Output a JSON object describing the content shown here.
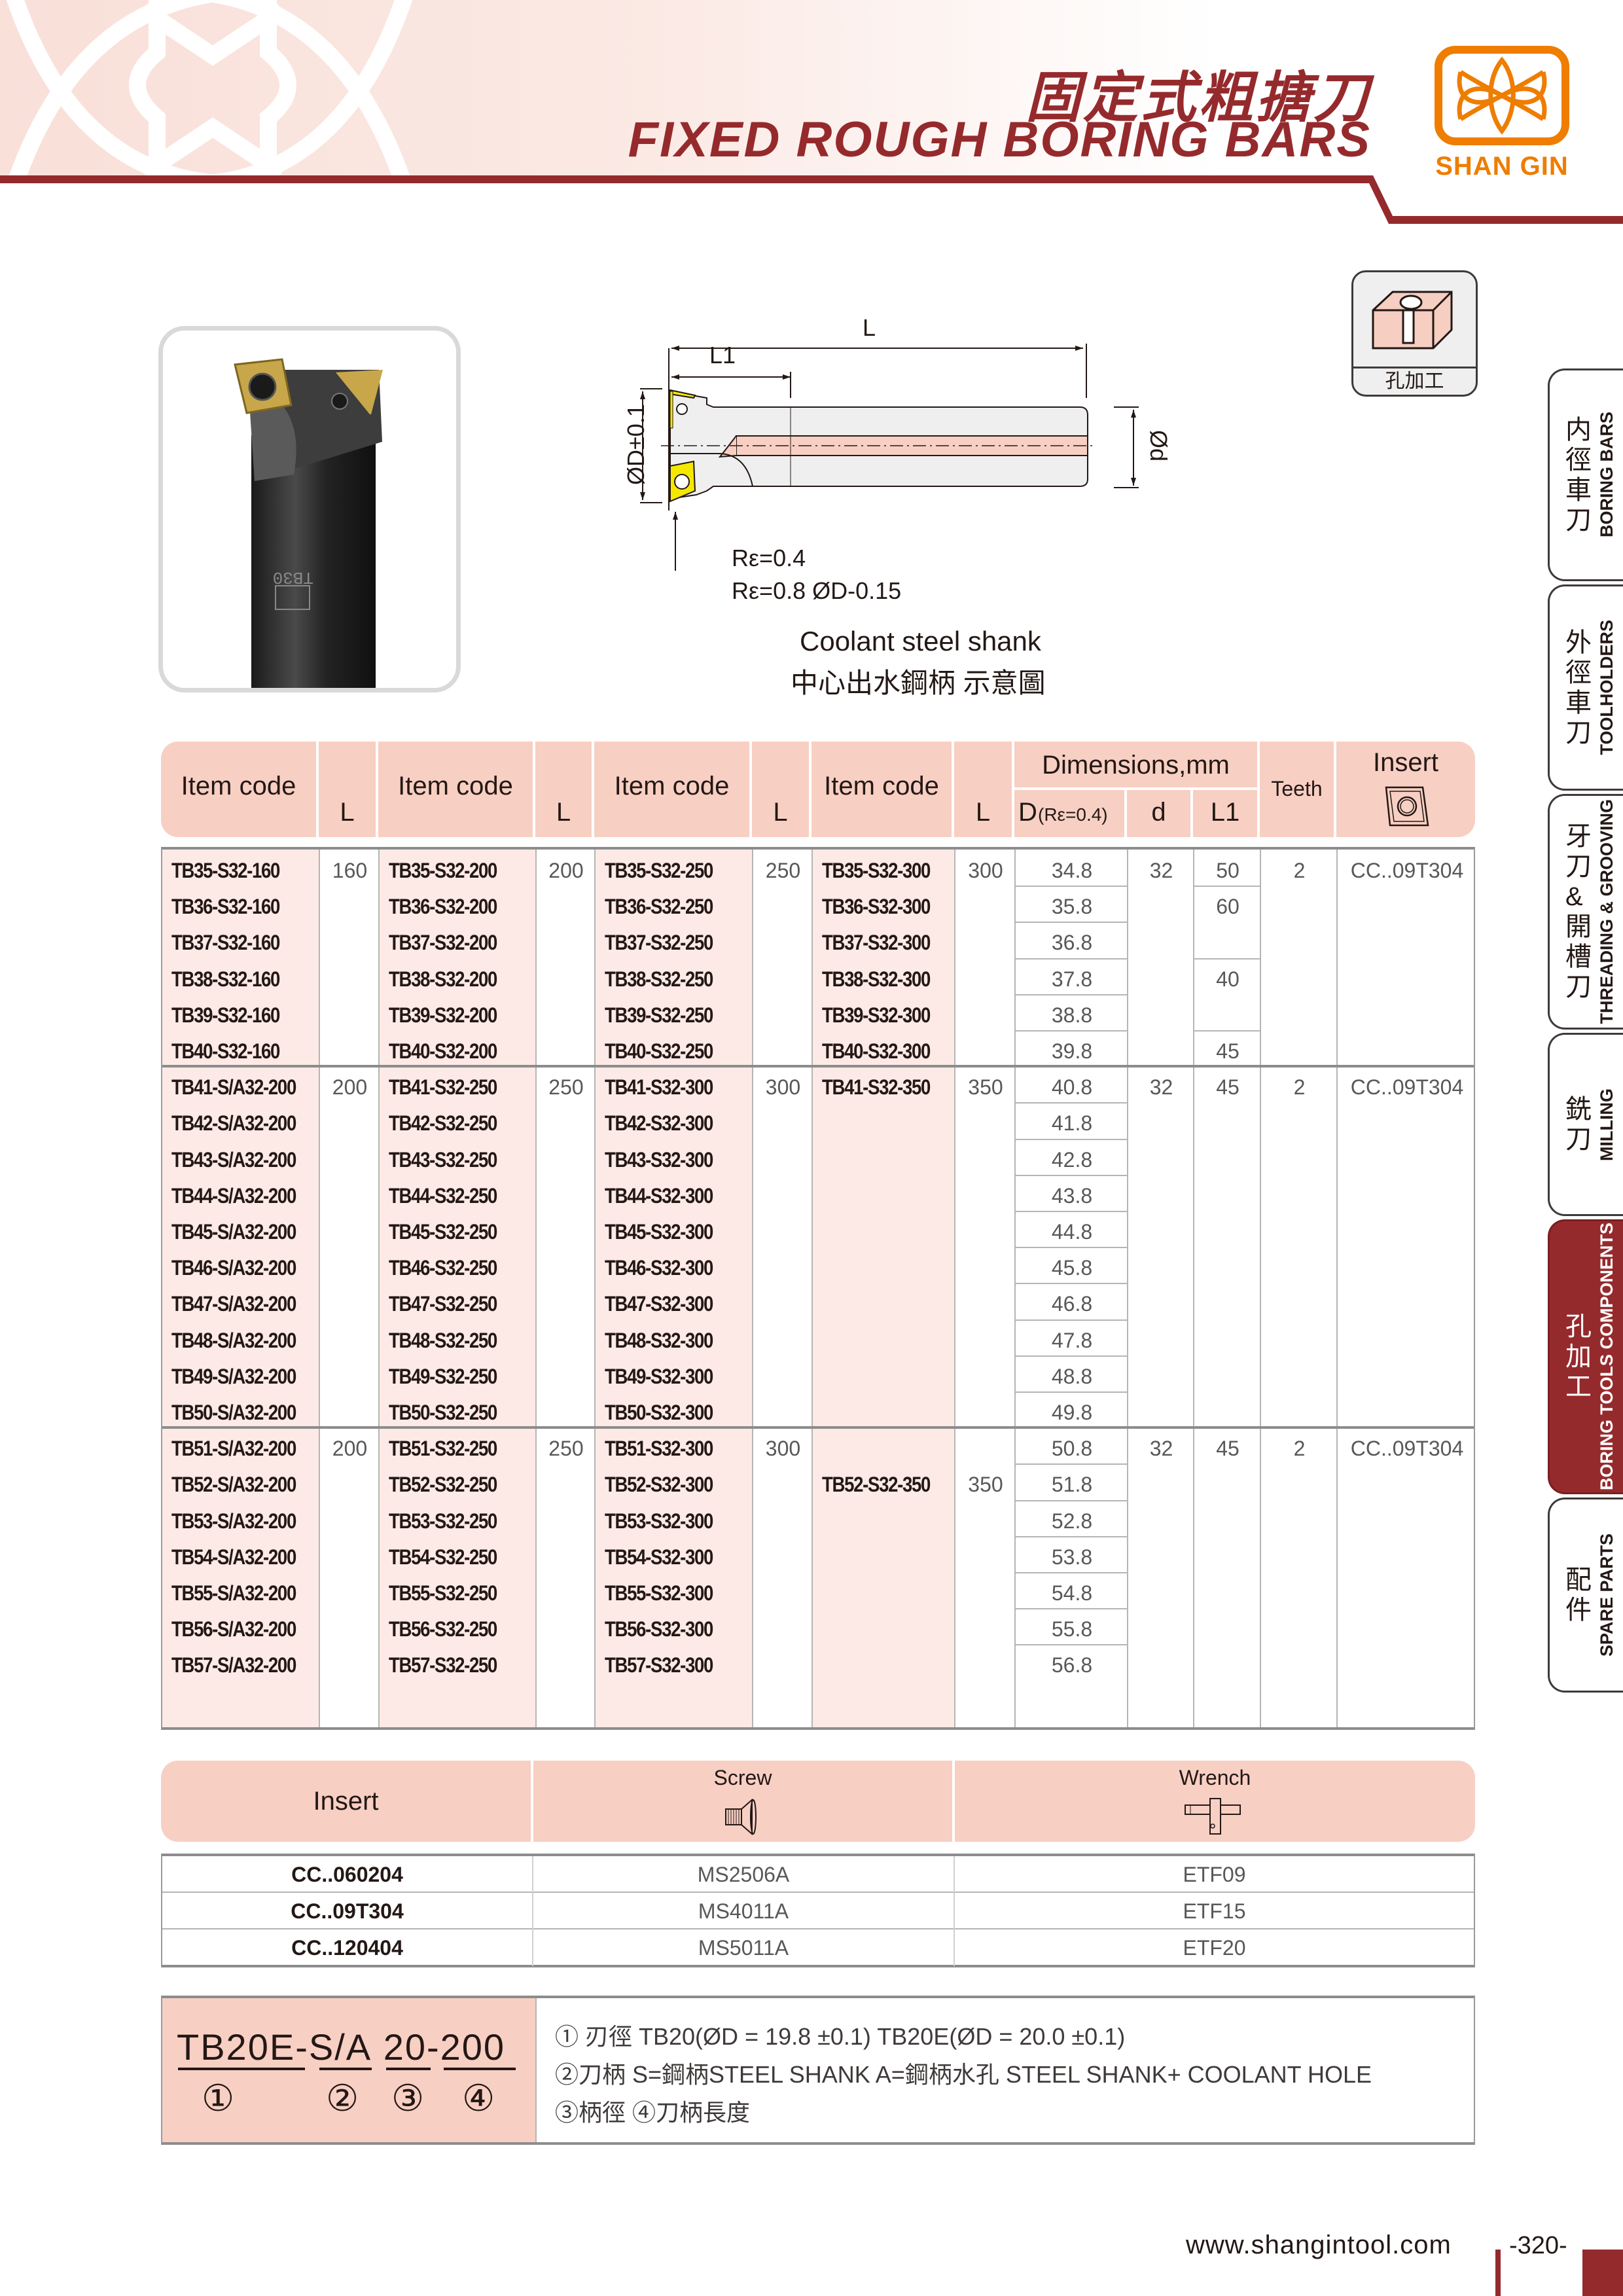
{
  "header": {
    "title_cn": "固定式粗搪刀",
    "title_en": "FIXED ROUGH BORING BARS",
    "brand": "SHAN GIN",
    "brand_color": "#ee7d00",
    "accent_color": "#952a2d"
  },
  "category_icon": {
    "label": "孔加工",
    "icon": "hole-machining-icon"
  },
  "side_tabs": [
    {
      "cn": [
        "内",
        "徑",
        "車",
        "刀"
      ],
      "en": "BORING BARS",
      "active": false
    },
    {
      "cn": [
        "外",
        "徑",
        "車",
        "刀"
      ],
      "en": "TOOLHOLDERS",
      "active": false
    },
    {
      "cn": [
        "牙",
        "刀",
        "&",
        "開",
        "槽",
        "刀"
      ],
      "en": "THREADING & GROOVING",
      "active": false
    },
    {
      "cn": [
        "銑",
        "刀"
      ],
      "en": "MILLING",
      "active": false
    },
    {
      "cn": [
        "孔",
        "加",
        "工"
      ],
      "en": "BORING TOOLS COMPONENTS",
      "active": true
    },
    {
      "cn": [
        "配",
        "件"
      ],
      "en": "SPARE PARTS",
      "active": false
    }
  ],
  "drawing": {
    "L": "L",
    "L1": "L1",
    "D_label": "ØD±0.1",
    "d_label": "Ød",
    "re1": "Rε=0.4",
    "re2": "Rε=0.8 ØD-0.15",
    "caption_en": "Coolant steel shank",
    "caption_cn": "中心出水鋼柄  示意圖"
  },
  "main_table": {
    "headers": {
      "item_code": "Item code",
      "L": "L",
      "dimensions": "Dimensions,mm",
      "D": "D",
      "D_sub": "(Rε=0.4)",
      "d": "d",
      "L1": "L1",
      "teeth": "Teeth",
      "insert": "Insert"
    },
    "groups": [
      {
        "col1": {
          "L": "160",
          "codes": [
            "TB35-S32-160",
            "TB36-S32-160",
            "TB37-S32-160",
            "TB38-S32-160",
            "TB39-S32-160",
            "TB40-S32-160"
          ]
        },
        "col2": {
          "L": "200",
          "codes": [
            "TB35-S32-200",
            "TB36-S32-200",
            "TB37-S32-200",
            "TB38-S32-200",
            "TB39-S32-200",
            "TB40-S32-200"
          ]
        },
        "col3": {
          "L": "250",
          "codes": [
            "TB35-S32-250",
            "TB36-S32-250",
            "TB37-S32-250",
            "TB38-S32-250",
            "TB39-S32-250",
            "TB40-S32-250"
          ]
        },
        "col4": {
          "L": "300",
          "codes": [
            "TB35-S32-300",
            "TB36-S32-300",
            "TB37-S32-300",
            "TB38-S32-300",
            "TB39-S32-300",
            "TB40-S32-300"
          ],
          "code_row": 0
        },
        "D": [
          "34.8",
          "35.8",
          "36.8",
          "37.8",
          "38.8",
          "39.8"
        ],
        "d": "32",
        "L1": [
          {
            "value": "50",
            "span": 1
          },
          {
            "value": "60",
            "span": 2
          },
          {
            "value": "40",
            "span": 2
          },
          {
            "value": "45",
            "span": 1
          }
        ],
        "teeth": "2",
        "insert": "CC..09T304"
      },
      {
        "col1": {
          "L": "200",
          "codes": [
            "TB41-S/A32-200",
            "TB42-S/A32-200",
            "TB43-S/A32-200",
            "TB44-S/A32-200",
            "TB45-S/A32-200",
            "TB46-S/A32-200",
            "TB47-S/A32-200",
            "TB48-S/A32-200",
            "TB49-S/A32-200",
            "TB50-S/A32-200"
          ]
        },
        "col2": {
          "L": "250",
          "codes": [
            "TB41-S32-250",
            "TB42-S32-250",
            "TB43-S32-250",
            "TB44-S32-250",
            "TB45-S32-250",
            "TB46-S32-250",
            "TB47-S32-250",
            "TB48-S32-250",
            "TB49-S32-250",
            "TB50-S32-250"
          ]
        },
        "col3": {
          "L": "300",
          "codes": [
            "TB41-S32-300",
            "TB42-S32-300",
            "TB43-S32-300",
            "TB44-S32-300",
            "TB45-S32-300",
            "TB46-S32-300",
            "TB47-S32-300",
            "TB48-S32-300",
            "TB49-S32-300",
            "TB50-S32-300"
          ]
        },
        "col4": {
          "L": "350",
          "codes": [
            "TB41-S32-350"
          ],
          "code_row": 0
        },
        "D": [
          "40.8",
          "41.8",
          "42.8",
          "43.8",
          "44.8",
          "45.8",
          "46.8",
          "47.8",
          "48.8",
          "49.8"
        ],
        "d": "32",
        "L1": [
          {
            "value": "45",
            "span": 10
          }
        ],
        "teeth": "2",
        "insert": "CC..09T304"
      },
      {
        "col1": {
          "L": "200",
          "codes": [
            "TB51-S/A32-200",
            "TB52-S/A32-200",
            "TB53-S/A32-200",
            "TB54-S/A32-200",
            "TB55-S/A32-200",
            "TB56-S/A32-200",
            "TB57-S/A32-200"
          ]
        },
        "col2": {
          "L": "250",
          "codes": [
            "TB51-S32-250",
            "TB52-S32-250",
            "TB53-S32-250",
            "TB54-S32-250",
            "TB55-S32-250",
            "TB56-S32-250",
            "TB57-S32-250"
          ]
        },
        "col3": {
          "L": "300",
          "codes": [
            "TB51-S32-300",
            "TB52-S32-300",
            "TB53-S32-300",
            "TB54-S32-300",
            "TB55-S32-300",
            "TB56-S32-300",
            "TB57-S32-300"
          ]
        },
        "col4": {
          "L": "350",
          "codes": [
            "TB52-S32-350"
          ],
          "code_row": 1
        },
        "D": [
          "50.8",
          "51.8",
          "52.8",
          "53.8",
          "54.8",
          "55.8",
          "56.8"
        ],
        "d": "32",
        "L1": [
          {
            "value": "45",
            "span": 7
          }
        ],
        "teeth": "2",
        "insert": "CC..09T304"
      }
    ]
  },
  "insert_table": {
    "headers": {
      "insert": "Insert",
      "screw": "Screw",
      "wrench": "Wrench"
    },
    "rows": [
      {
        "insert": "CC..060204",
        "screw": "MS2506A",
        "wrench": "ETF09"
      },
      {
        "insert": "CC..09T304",
        "screw": "MS4011A",
        "wrench": "ETF15"
      },
      {
        "insert": "CC..120404",
        "screw": "MS5011A",
        "wrench": "ETF20"
      }
    ]
  },
  "code_legend": {
    "parts": [
      "TB20E",
      "-",
      "S/A",
      "20",
      "-",
      "200"
    ],
    "markers": [
      "①",
      "②",
      "③",
      "④"
    ],
    "lines": [
      "① 刃徑  TB20(ØD = 19.8 ±0.1)     TB20E(ØD = 20.0 ±0.1)",
      "②刀柄   S=鋼柄STEEL SHANK     A=鋼柄水孔 STEEL SHANK+ COOLANT HOLE",
      "③柄徑   ④刀柄長度"
    ]
  },
  "footer": {
    "url": "www.shangintool.com",
    "page": "-320-"
  }
}
